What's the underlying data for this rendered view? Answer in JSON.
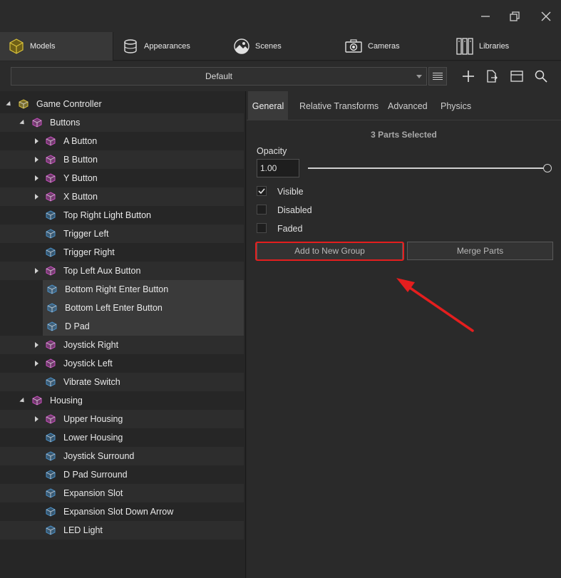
{
  "window": {
    "controls": [
      "minimize-icon",
      "restore-icon",
      "close-icon"
    ]
  },
  "tabs": [
    {
      "label": "Models",
      "icon": "cube-icon",
      "active": true
    },
    {
      "label": "Appearances",
      "icon": "cylinder-icon",
      "active": false
    },
    {
      "label": "Scenes",
      "icon": "landscape-icon",
      "active": false
    },
    {
      "label": "Cameras",
      "icon": "camera-icon",
      "active": false
    },
    {
      "label": "Libraries",
      "icon": "books-icon",
      "active": false
    }
  ],
  "toolbar": {
    "preset_value": "Default",
    "actions": [
      "add-icon",
      "export-icon",
      "layout-icon",
      "search-icon"
    ]
  },
  "tree": [
    {
      "label": "Game Controller",
      "level": 0,
      "expander": "expanded",
      "icon": "model-icon"
    },
    {
      "label": "Buttons",
      "level": 1,
      "expander": "expanded",
      "icon": "group-icon"
    },
    {
      "label": "A Button",
      "level": 2,
      "expander": "collapsed",
      "icon": "group-icon"
    },
    {
      "label": "B Button",
      "level": 2,
      "expander": "collapsed",
      "icon": "group-icon"
    },
    {
      "label": "Y Button",
      "level": 2,
      "expander": "collapsed",
      "icon": "group-icon"
    },
    {
      "label": "X Button",
      "level": 2,
      "expander": "collapsed",
      "icon": "group-icon"
    },
    {
      "label": "Top Right Light Button",
      "level": 2,
      "expander": "none",
      "icon": "part-icon"
    },
    {
      "label": "Trigger Left",
      "level": 2,
      "expander": "none",
      "icon": "part-icon"
    },
    {
      "label": "Trigger Right",
      "level": 2,
      "expander": "none",
      "icon": "part-icon"
    },
    {
      "label": "Top Left Aux Button",
      "level": 2,
      "expander": "collapsed",
      "icon": "group-icon"
    },
    {
      "label": "Bottom Right Enter Button",
      "level": 2,
      "expander": "none",
      "icon": "part-icon",
      "selected": true
    },
    {
      "label": "Bottom Left Enter Button",
      "level": 2,
      "expander": "none",
      "icon": "part-icon",
      "selected": true
    },
    {
      "label": "D Pad",
      "level": 2,
      "expander": "none",
      "icon": "part-icon",
      "selected": true
    },
    {
      "label": "Joystick Right",
      "level": 2,
      "expander": "collapsed",
      "icon": "group-icon"
    },
    {
      "label": "Joystick Left",
      "level": 2,
      "expander": "collapsed",
      "icon": "group-icon"
    },
    {
      "label": "Vibrate Switch",
      "level": 2,
      "expander": "none",
      "icon": "part-icon"
    },
    {
      "label": "Housing",
      "level": 1,
      "expander": "expanded",
      "icon": "group-icon"
    },
    {
      "label": "Upper Housing",
      "level": 2,
      "expander": "collapsed",
      "icon": "group-icon"
    },
    {
      "label": "Lower Housing",
      "level": 2,
      "expander": "none",
      "icon": "part-icon"
    },
    {
      "label": "Joystick Surround",
      "level": 2,
      "expander": "none",
      "icon": "part-icon"
    },
    {
      "label": "D Pad Surround",
      "level": 2,
      "expander": "none",
      "icon": "part-icon"
    },
    {
      "label": "Expansion Slot",
      "level": 2,
      "expander": "none",
      "icon": "part-icon"
    },
    {
      "label": "Expansion Slot  Down Arrow",
      "level": 2,
      "expander": "none",
      "icon": "part-icon"
    },
    {
      "label": "LED Light",
      "level": 2,
      "expander": "none",
      "icon": "part-icon"
    }
  ],
  "properties": {
    "tabs": [
      "General",
      "Relative Transforms",
      "Advanced",
      "Physics"
    ],
    "active_tab": "General",
    "selection_info": "3 Parts Selected",
    "opacity_label": "Opacity",
    "opacity_value": "1.00",
    "opacity_level": 1.0,
    "checkboxes": [
      {
        "label": "Visible",
        "checked": true
      },
      {
        "label": "Disabled",
        "checked": false
      },
      {
        "label": "Faded",
        "checked": false
      }
    ],
    "add_group_label": "Add to New Group",
    "merge_label": "Merge Parts"
  },
  "annotation": {
    "highlight_color": "#e41e1e",
    "arrow_icon": "red-arrow-icon"
  },
  "colors": {
    "model_icon": "#d9c13b",
    "group_icon": "#c94fc0",
    "part_icon": "#4a90c8"
  }
}
